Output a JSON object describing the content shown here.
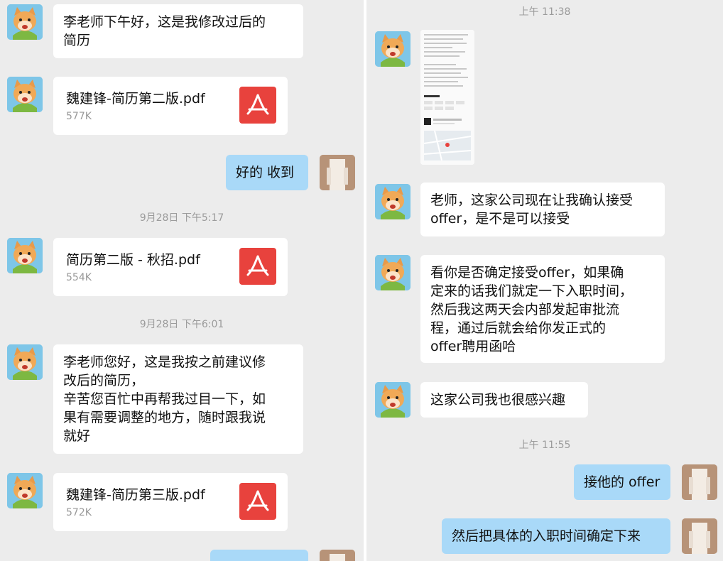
{
  "left_pane": {
    "messages": {
      "m1": "李老师下午好，这是我修改过后的\n简历",
      "file1": {
        "name": "魏建锋-简历第二版.pdf",
        "size": "577K"
      },
      "m2": "好的 收到",
      "ts1": "9月28日 下午5:17",
      "file2": {
        "name": "简历第二版 - 秋招.pdf",
        "size": "554K"
      },
      "ts2": "9月28日 下午6:01",
      "m3": "李老师您好，这是我按之前建议修\n改后的简历，\n辛苦您百忙中再帮我过目一下，如\n果有需要调整的地方，随时跟我说\n就好",
      "file3": {
        "name": "魏建锋-简历第三版.pdf",
        "size": "572K"
      }
    }
  },
  "right_pane": {
    "messages": {
      "ts1": "上午 11:38",
      "m1": "老师，这家公司现在让我确认接受\noffer，是不是可以接受",
      "m2": "看你是否确定接受offer，如果确\n定来的话我们就定一下入职时间，\n然后我这两天会内部发起审批流\n程，通过后就会给你发正式的\noffer聘用函哈",
      "m3": "这家公司我也很感兴趣",
      "ts2": "上午 11:55",
      "m4": "接他的 offer",
      "m5": "然后把具体的入职时间确定下来"
    }
  },
  "colors": {
    "background": "#ececec",
    "incoming_bubble": "#ffffff",
    "outgoing_bubble": "#a9d9f8",
    "pdf_red": "#e8423d",
    "timestamp_text": "#9b9b9b"
  },
  "icons": {
    "contact_avatar": "fox-cartoon-avatar",
    "self_avatar": "photo-avatar",
    "file_type": "pdf-icon"
  }
}
